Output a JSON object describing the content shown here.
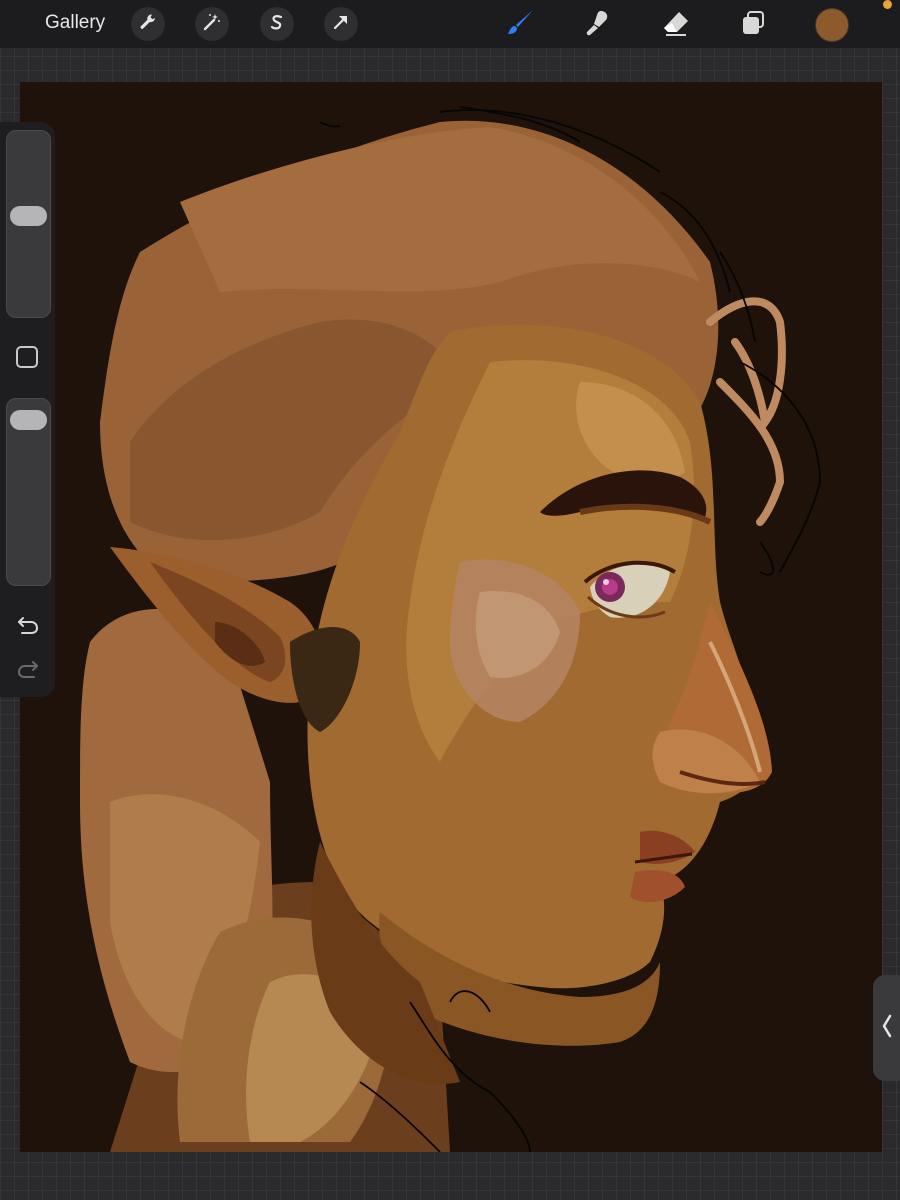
{
  "topbar": {
    "gallery_label": "Gallery",
    "tools": [
      {
        "icon": "wrench-icon",
        "name": "actions"
      },
      {
        "icon": "magic-wand-icon",
        "name": "adjustments"
      },
      {
        "icon": "selection-icon",
        "name": "selection"
      },
      {
        "icon": "transform-arrow-icon",
        "name": "transform"
      }
    ],
    "right_tools": [
      {
        "icon": "brush-icon",
        "name": "paint",
        "active": true
      },
      {
        "icon": "smudge-icon",
        "name": "smudge",
        "active": false
      },
      {
        "icon": "eraser-icon",
        "name": "erase",
        "active": false
      },
      {
        "icon": "layers-icon",
        "name": "layers",
        "active": false
      }
    ],
    "current_color": "#8c5a2c",
    "status_dot_color": "#e8a33a"
  },
  "sidebar": {
    "brush_size_level": 0.55,
    "opacity_level": 0.95
  },
  "colors": {
    "accent_blue": "#2d7ff9",
    "canvas_bg": "#1e120b"
  }
}
